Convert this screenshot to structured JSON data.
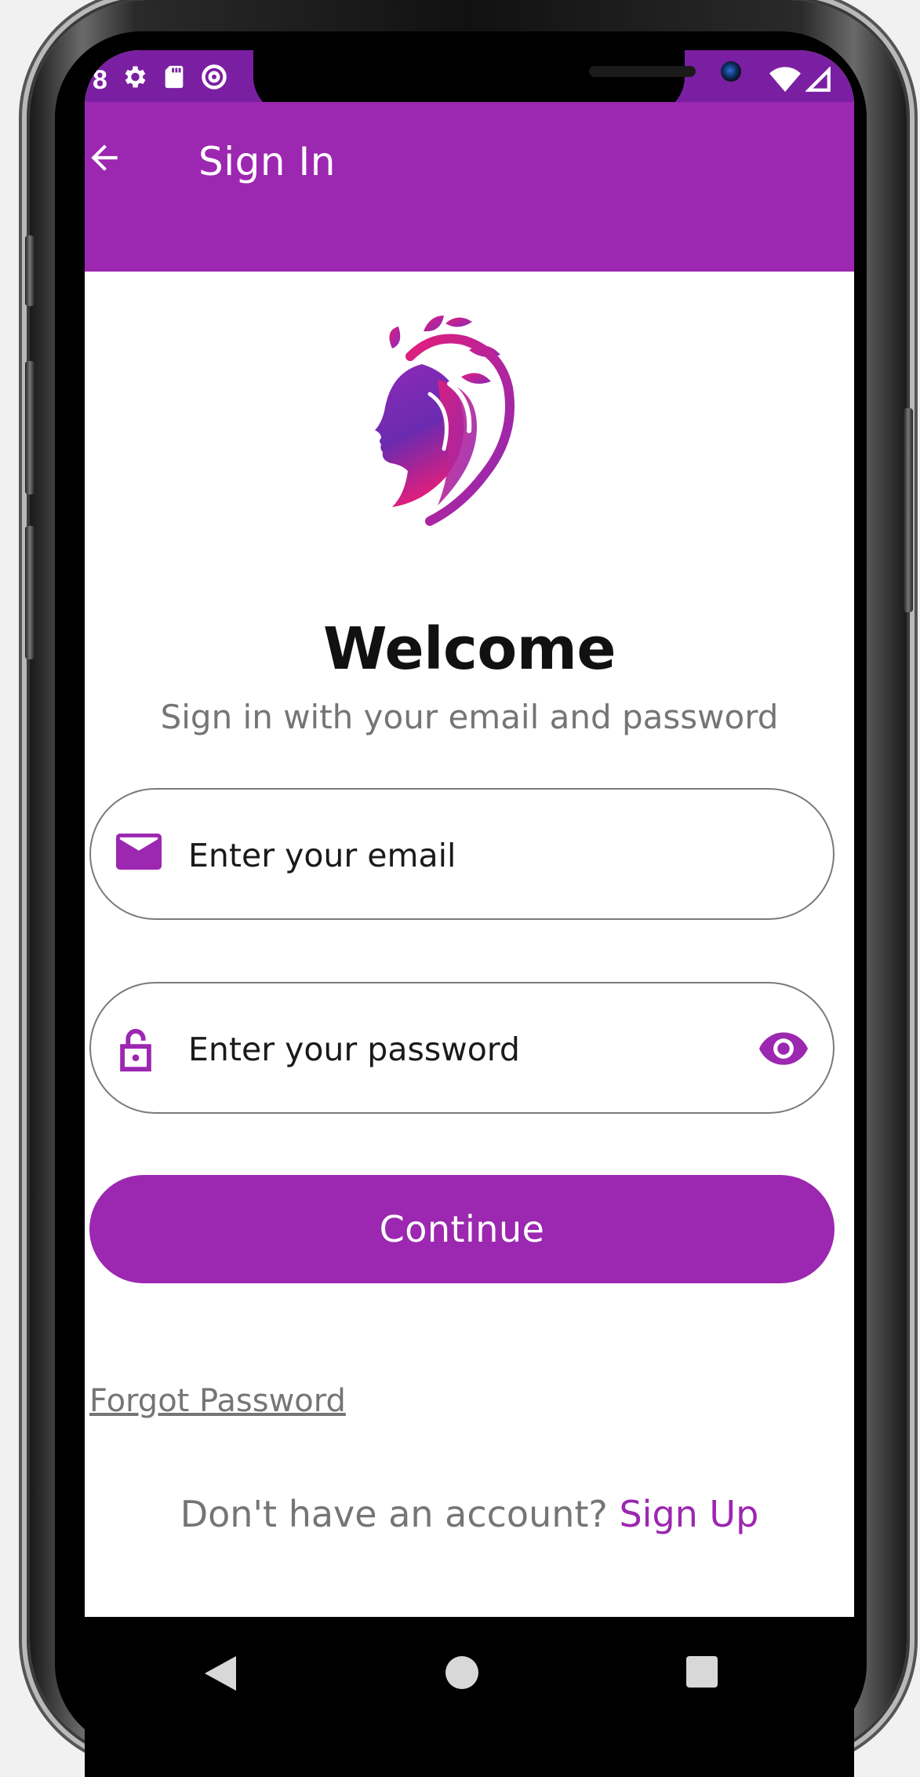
{
  "status_bar": {
    "time_fragment": "8",
    "icons": [
      "gear-icon",
      "sd-card-icon",
      "at-sign-icon"
    ],
    "right_icons": [
      "wifi-icon",
      "signal-icon"
    ]
  },
  "app_bar": {
    "back_icon": "arrow-left-icon",
    "title": "Sign In"
  },
  "main": {
    "welcome_title": "Welcome",
    "subtitle": "Sign in with your email and password",
    "email_field": {
      "icon": "envelope-icon",
      "placeholder": "Enter your email",
      "value": ""
    },
    "password_field": {
      "icon": "lock-icon",
      "placeholder": "Enter your password",
      "value": "",
      "toggle_icon": "eye-icon"
    },
    "continue_label": "Continue",
    "forgot_password": "Forgot Password",
    "signup_prompt": "Don't have an account? ",
    "signup_link": "Sign Up"
  },
  "nav_bar": {
    "icons": [
      "nav-back-icon",
      "nav-home-icon",
      "nav-recents-icon"
    ]
  },
  "colors": {
    "primary": "#9c27b0",
    "status_bar": "#7b1fa2",
    "text_secondary": "#757575"
  }
}
